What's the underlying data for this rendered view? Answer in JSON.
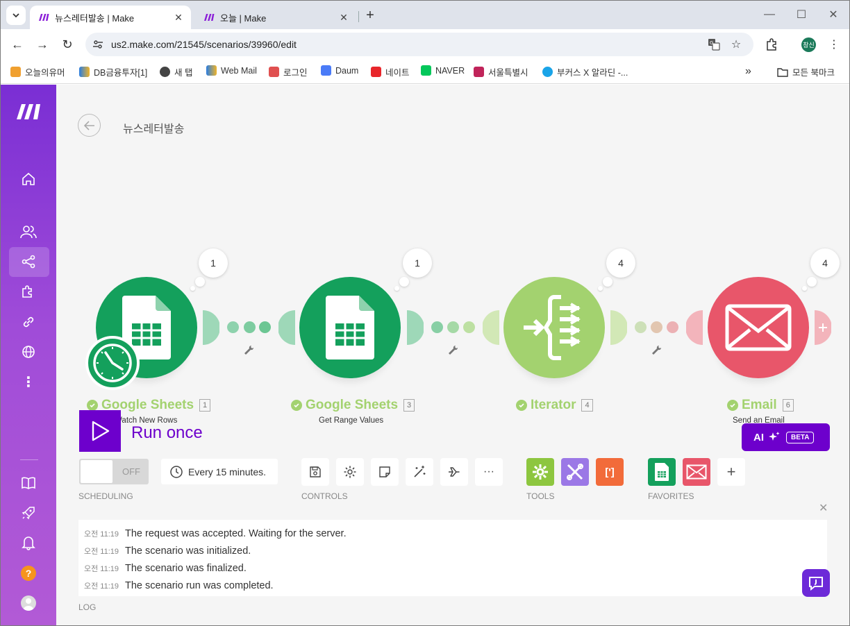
{
  "browser": {
    "tabs": [
      {
        "title": "뉴스레터발송 | Make",
        "active": true
      },
      {
        "title": "오늘 | Make",
        "active": false
      }
    ],
    "url": "us2.make.com/21545/scenarios/39960/edit",
    "profile_initials": "창신",
    "bookmarks": [
      "오늘의유머",
      "DB금융투자[1]",
      "새 탭",
      "Web Mail",
      "로그인",
      "Daum",
      "네이트",
      "NAVER",
      "서울특별시",
      "부커스 X 알라딘 -...",
      "모든 북마크"
    ]
  },
  "scenario": {
    "title": "뉴스레터발송",
    "modules": [
      {
        "name": "Google Sheets",
        "id": "1",
        "action": "Watch New Rows",
        "bundles": "1",
        "color": "#14a05c"
      },
      {
        "name": "Google Sheets",
        "id": "3",
        "action": "Get Range Values",
        "bundles": "1",
        "color": "#14a05c"
      },
      {
        "name": "Iterator",
        "id": "4",
        "action": "",
        "bundles": "4",
        "color": "#a3d26f"
      },
      {
        "name": "Email",
        "id": "6",
        "action": "Send an Email",
        "bundles": "4",
        "color": "#e8566a"
      }
    ]
  },
  "toolbar": {
    "run_once": "Run once",
    "ai_label": "AI",
    "ai_badge": "BETA",
    "toggle_state": "OFF",
    "schedule": "Every 15 minutes.",
    "sections": {
      "scheduling": "SCHEDULING",
      "controls": "CONTROLS",
      "tools": "TOOLS",
      "favorites": "FAVORITES"
    }
  },
  "log": {
    "title": "LOG",
    "entries": [
      {
        "time": "오전 11:19",
        "message": "The request was accepted. Waiting for the server."
      },
      {
        "time": "오전 11:19",
        "message": "The scenario was initialized."
      },
      {
        "time": "오전 11:19",
        "message": "The scenario was finalized."
      },
      {
        "time": "오전 11:19",
        "message": "The scenario run was completed."
      }
    ]
  }
}
